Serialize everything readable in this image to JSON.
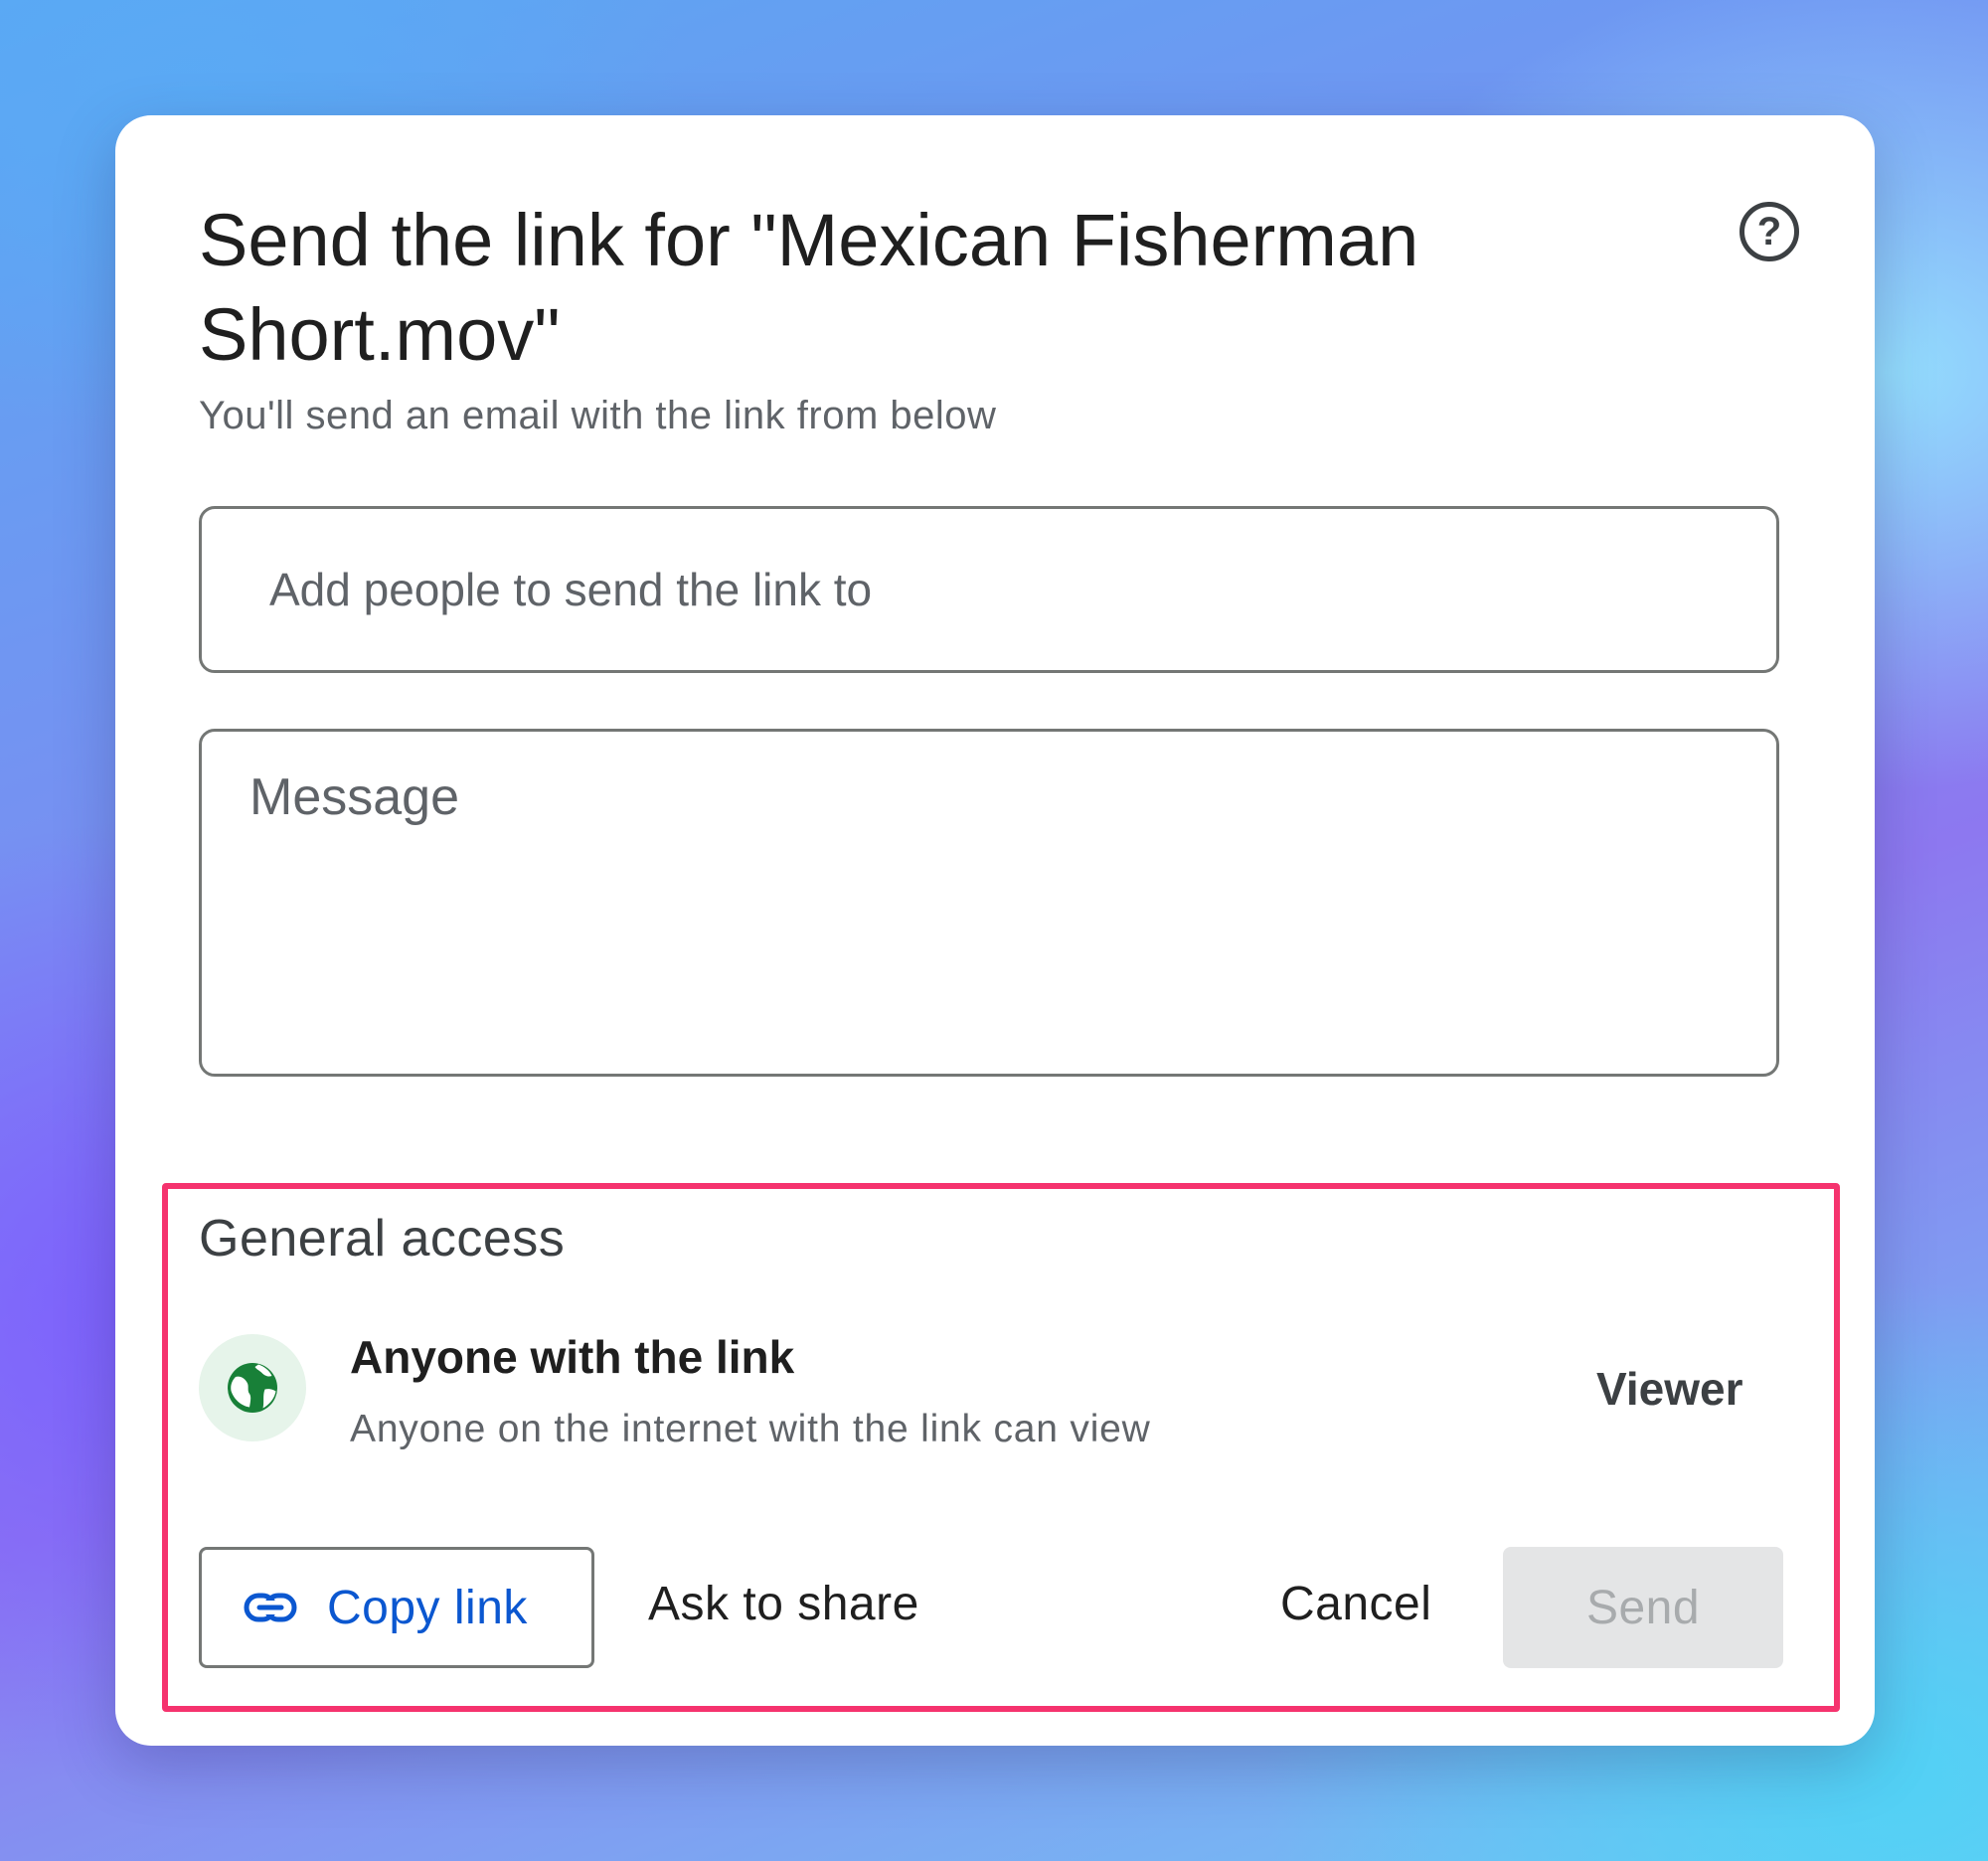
{
  "dialog": {
    "title": "Send the link for \"Mexican Fisherman Short.mov\"",
    "subtitle": "You'll send an email with the link from below",
    "help_icon": "help-circle-icon"
  },
  "recipients": {
    "placeholder": "Add people to send the link to"
  },
  "message": {
    "placeholder": "Message"
  },
  "general_access": {
    "heading": "General access",
    "icon": "globe-icon",
    "access_title": "Anyone with the link",
    "access_description": "Anyone on the internet with the link can view",
    "role": "Viewer"
  },
  "actions": {
    "copy_link": "Copy link",
    "copy_link_icon": "link-icon",
    "ask_to_share": "Ask to share",
    "cancel": "Cancel",
    "send": "Send"
  },
  "colors": {
    "accent": "#0b57d0",
    "highlight": "#f5336e",
    "globe": "#188038",
    "globe_bg": "#e6f4ea"
  }
}
